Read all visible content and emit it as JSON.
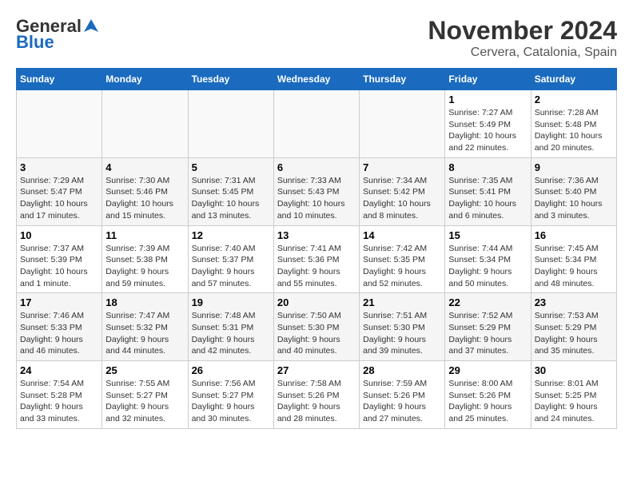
{
  "header": {
    "logo_general": "General",
    "logo_blue": "Blue",
    "title": "November 2024",
    "subtitle": "Cervera, Catalonia, Spain"
  },
  "calendar": {
    "weekdays": [
      "Sunday",
      "Monday",
      "Tuesday",
      "Wednesday",
      "Thursday",
      "Friday",
      "Saturday"
    ],
    "weeks": [
      [
        {
          "day": "",
          "info": ""
        },
        {
          "day": "",
          "info": ""
        },
        {
          "day": "",
          "info": ""
        },
        {
          "day": "",
          "info": ""
        },
        {
          "day": "",
          "info": ""
        },
        {
          "day": "1",
          "info": "Sunrise: 7:27 AM\nSunset: 5:49 PM\nDaylight: 10 hours and 22 minutes."
        },
        {
          "day": "2",
          "info": "Sunrise: 7:28 AM\nSunset: 5:48 PM\nDaylight: 10 hours and 20 minutes."
        }
      ],
      [
        {
          "day": "3",
          "info": "Sunrise: 7:29 AM\nSunset: 5:47 PM\nDaylight: 10 hours and 17 minutes."
        },
        {
          "day": "4",
          "info": "Sunrise: 7:30 AM\nSunset: 5:46 PM\nDaylight: 10 hours and 15 minutes."
        },
        {
          "day": "5",
          "info": "Sunrise: 7:31 AM\nSunset: 5:45 PM\nDaylight: 10 hours and 13 minutes."
        },
        {
          "day": "6",
          "info": "Sunrise: 7:33 AM\nSunset: 5:43 PM\nDaylight: 10 hours and 10 minutes."
        },
        {
          "day": "7",
          "info": "Sunrise: 7:34 AM\nSunset: 5:42 PM\nDaylight: 10 hours and 8 minutes."
        },
        {
          "day": "8",
          "info": "Sunrise: 7:35 AM\nSunset: 5:41 PM\nDaylight: 10 hours and 6 minutes."
        },
        {
          "day": "9",
          "info": "Sunrise: 7:36 AM\nSunset: 5:40 PM\nDaylight: 10 hours and 3 minutes."
        }
      ],
      [
        {
          "day": "10",
          "info": "Sunrise: 7:37 AM\nSunset: 5:39 PM\nDaylight: 10 hours and 1 minute."
        },
        {
          "day": "11",
          "info": "Sunrise: 7:39 AM\nSunset: 5:38 PM\nDaylight: 9 hours and 59 minutes."
        },
        {
          "day": "12",
          "info": "Sunrise: 7:40 AM\nSunset: 5:37 PM\nDaylight: 9 hours and 57 minutes."
        },
        {
          "day": "13",
          "info": "Sunrise: 7:41 AM\nSunset: 5:36 PM\nDaylight: 9 hours and 55 minutes."
        },
        {
          "day": "14",
          "info": "Sunrise: 7:42 AM\nSunset: 5:35 PM\nDaylight: 9 hours and 52 minutes."
        },
        {
          "day": "15",
          "info": "Sunrise: 7:44 AM\nSunset: 5:34 PM\nDaylight: 9 hours and 50 minutes."
        },
        {
          "day": "16",
          "info": "Sunrise: 7:45 AM\nSunset: 5:34 PM\nDaylight: 9 hours and 48 minutes."
        }
      ],
      [
        {
          "day": "17",
          "info": "Sunrise: 7:46 AM\nSunset: 5:33 PM\nDaylight: 9 hours and 46 minutes."
        },
        {
          "day": "18",
          "info": "Sunrise: 7:47 AM\nSunset: 5:32 PM\nDaylight: 9 hours and 44 minutes."
        },
        {
          "day": "19",
          "info": "Sunrise: 7:48 AM\nSunset: 5:31 PM\nDaylight: 9 hours and 42 minutes."
        },
        {
          "day": "20",
          "info": "Sunrise: 7:50 AM\nSunset: 5:30 PM\nDaylight: 9 hours and 40 minutes."
        },
        {
          "day": "21",
          "info": "Sunrise: 7:51 AM\nSunset: 5:30 PM\nDaylight: 9 hours and 39 minutes."
        },
        {
          "day": "22",
          "info": "Sunrise: 7:52 AM\nSunset: 5:29 PM\nDaylight: 9 hours and 37 minutes."
        },
        {
          "day": "23",
          "info": "Sunrise: 7:53 AM\nSunset: 5:29 PM\nDaylight: 9 hours and 35 minutes."
        }
      ],
      [
        {
          "day": "24",
          "info": "Sunrise: 7:54 AM\nSunset: 5:28 PM\nDaylight: 9 hours and 33 minutes."
        },
        {
          "day": "25",
          "info": "Sunrise: 7:55 AM\nSunset: 5:27 PM\nDaylight: 9 hours and 32 minutes."
        },
        {
          "day": "26",
          "info": "Sunrise: 7:56 AM\nSunset: 5:27 PM\nDaylight: 9 hours and 30 minutes."
        },
        {
          "day": "27",
          "info": "Sunrise: 7:58 AM\nSunset: 5:26 PM\nDaylight: 9 hours and 28 minutes."
        },
        {
          "day": "28",
          "info": "Sunrise: 7:59 AM\nSunset: 5:26 PM\nDaylight: 9 hours and 27 minutes."
        },
        {
          "day": "29",
          "info": "Sunrise: 8:00 AM\nSunset: 5:26 PM\nDaylight: 9 hours and 25 minutes."
        },
        {
          "day": "30",
          "info": "Sunrise: 8:01 AM\nSunset: 5:25 PM\nDaylight: 9 hours and 24 minutes."
        }
      ]
    ]
  }
}
